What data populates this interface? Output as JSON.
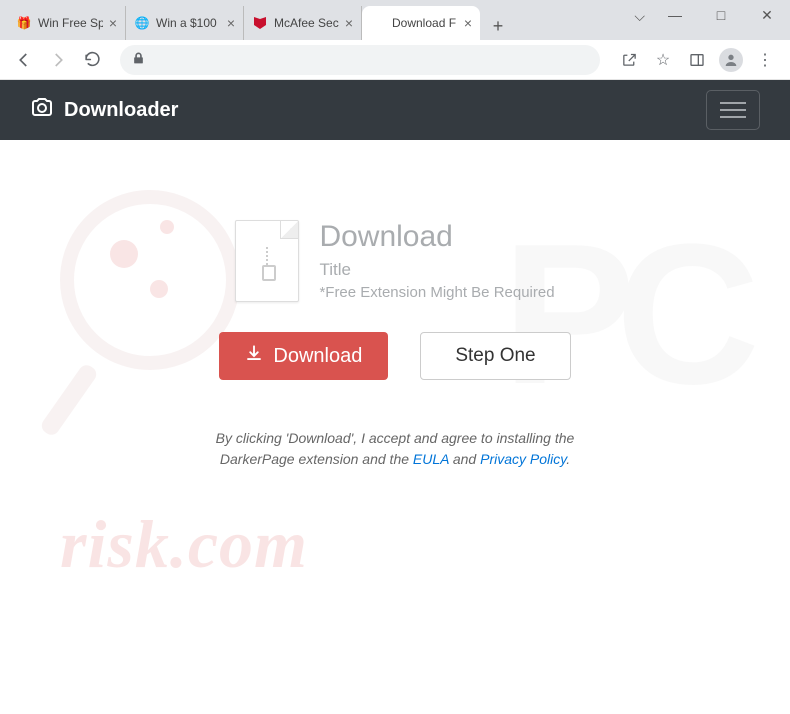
{
  "browser": {
    "tabs": [
      {
        "title": "Win Free Sp",
        "favicon": "gift"
      },
      {
        "title": "Win a $100",
        "favicon": "globe"
      },
      {
        "title": "McAfee Sec",
        "favicon": "mcafee"
      },
      {
        "title": "Download F",
        "favicon": "blank",
        "active": true
      }
    ],
    "window_controls": {
      "chevron": "⌵",
      "minimize": "—",
      "maximize": "□",
      "close": "✕"
    },
    "nav": {
      "back": "←",
      "forward": "→",
      "reload": "⟳"
    },
    "toolbar_icons": {
      "share": "share",
      "star": "☆",
      "panel": "▣",
      "avatar": "person",
      "menu": "⋮"
    }
  },
  "page": {
    "brand": "Downloader",
    "heading": "Download",
    "subtitle": "Title",
    "note": "*Free Extension Might Be Required",
    "download_btn": "Download",
    "step_btn": "Step One",
    "disclaimer_pre": "By clicking 'Download', I accept and agree to installing the DarkerPage extension and the ",
    "eula": "EULA",
    "disclaimer_mid": " and ",
    "privacy": "Privacy Policy",
    "disclaimer_post": "."
  },
  "watermark": "risk.com"
}
